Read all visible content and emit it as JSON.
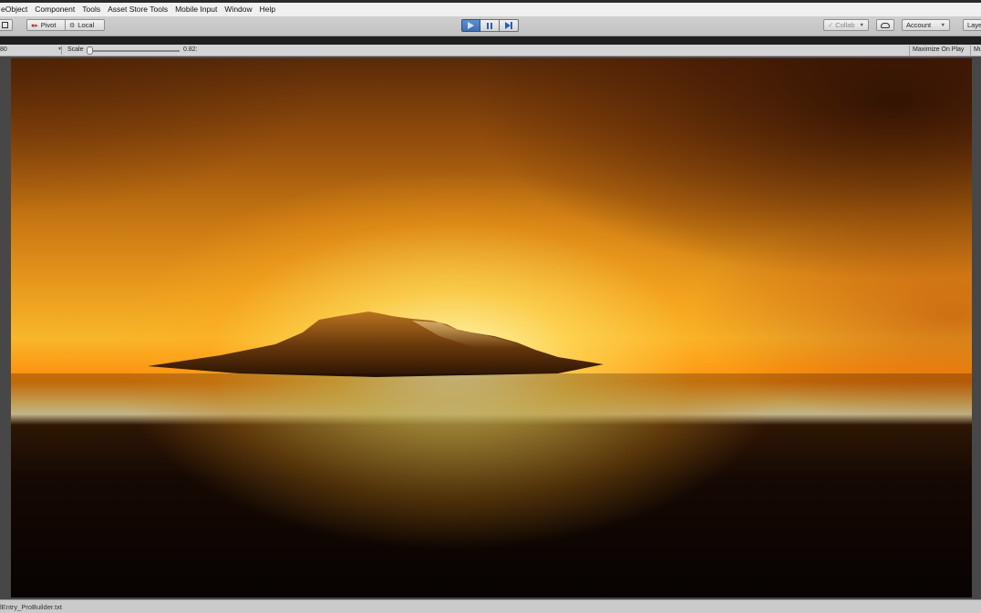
{
  "menu": {
    "items": [
      "eObject",
      "Component",
      "Tools",
      "Asset Store Tools",
      "Mobile Input",
      "Window",
      "Help"
    ]
  },
  "toolbar": {
    "pivot_label": "Pivot",
    "local_label": "Local",
    "collab_label": "Collab",
    "account_label": "Account",
    "layers_label": "Laye"
  },
  "game_view": {
    "resolution_label": "80",
    "scale_label": "Scale",
    "scale_value": "0.82:",
    "scale_fraction": 0.0,
    "maximize_label": "Maximize On Play",
    "mute_label": "Mu"
  },
  "status": {
    "message": "lEntry_ProBuilder.txt"
  },
  "colors": {
    "play_active": "#3e6fb4",
    "horizon_glow": "#fff0b8",
    "sky_orange": "#ec9f1f"
  },
  "icons": {
    "play": "play-icon",
    "pause": "pause-icon",
    "step": "step-icon"
  }
}
